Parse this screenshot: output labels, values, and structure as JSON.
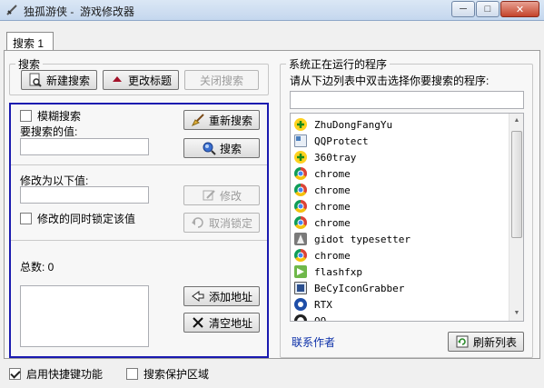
{
  "window": {
    "title": "独孤游侠 -  游戏修改器",
    "min_label": "─",
    "max_label": "□",
    "close_label": "✕"
  },
  "tabs": [
    "搜索 1"
  ],
  "search": {
    "legend": "搜索",
    "new_search": "新建搜索",
    "change_title": "更改标题",
    "close_search": "关闭搜索",
    "fuzzy_search": "模糊搜索",
    "fuzzy_checked": false,
    "value_label": "要搜索的值:",
    "value": "",
    "research": "重新搜索",
    "search_btn": "搜索",
    "modify_label": "修改为以下值:",
    "modify_value": "",
    "modify_btn": "修改",
    "lock_label": "修改的同时锁定该值",
    "lock_checked": false,
    "unlock_btn": "取消锁定",
    "total_label": "总数: 0",
    "add_address": "添加地址",
    "clear_address": "清空地址"
  },
  "processes": {
    "legend": "系统正在运行的程序",
    "hint": "请从下边列表中双击选择你要搜索的程序:",
    "filter_value": "",
    "items": [
      {
        "name": "ZhuDongFangYu",
        "icon": "plus-icon"
      },
      {
        "name": "QQProtect",
        "icon": "window-icon"
      },
      {
        "name": "360tray",
        "icon": "plus-icon"
      },
      {
        "name": "chrome",
        "icon": "chrome-icon"
      },
      {
        "name": "chrome",
        "icon": "chrome-icon"
      },
      {
        "name": "chrome",
        "icon": "chrome-icon"
      },
      {
        "name": "chrome",
        "icon": "chrome-icon"
      },
      {
        "name": "gidot typesetter",
        "icon": "gidot-icon"
      },
      {
        "name": "chrome",
        "icon": "chrome-icon"
      },
      {
        "name": "flashfxp",
        "icon": "flashfxp-icon"
      },
      {
        "name": "BeCyIconGrabber",
        "icon": "grabber-icon"
      },
      {
        "name": "RTX",
        "icon": "rtx-icon"
      },
      {
        "name": "QQ",
        "icon": "qq-icon"
      }
    ],
    "contact": "联系作者",
    "refresh": "刷新列表"
  },
  "footer": {
    "hotkey": "启用快捷键功能",
    "hotkey_checked": true,
    "protect_area": "搜索保护区域",
    "protect_checked": false
  },
  "colors": {
    "frame_blue": "#1a1ab0",
    "link": "#0b2fa8"
  }
}
